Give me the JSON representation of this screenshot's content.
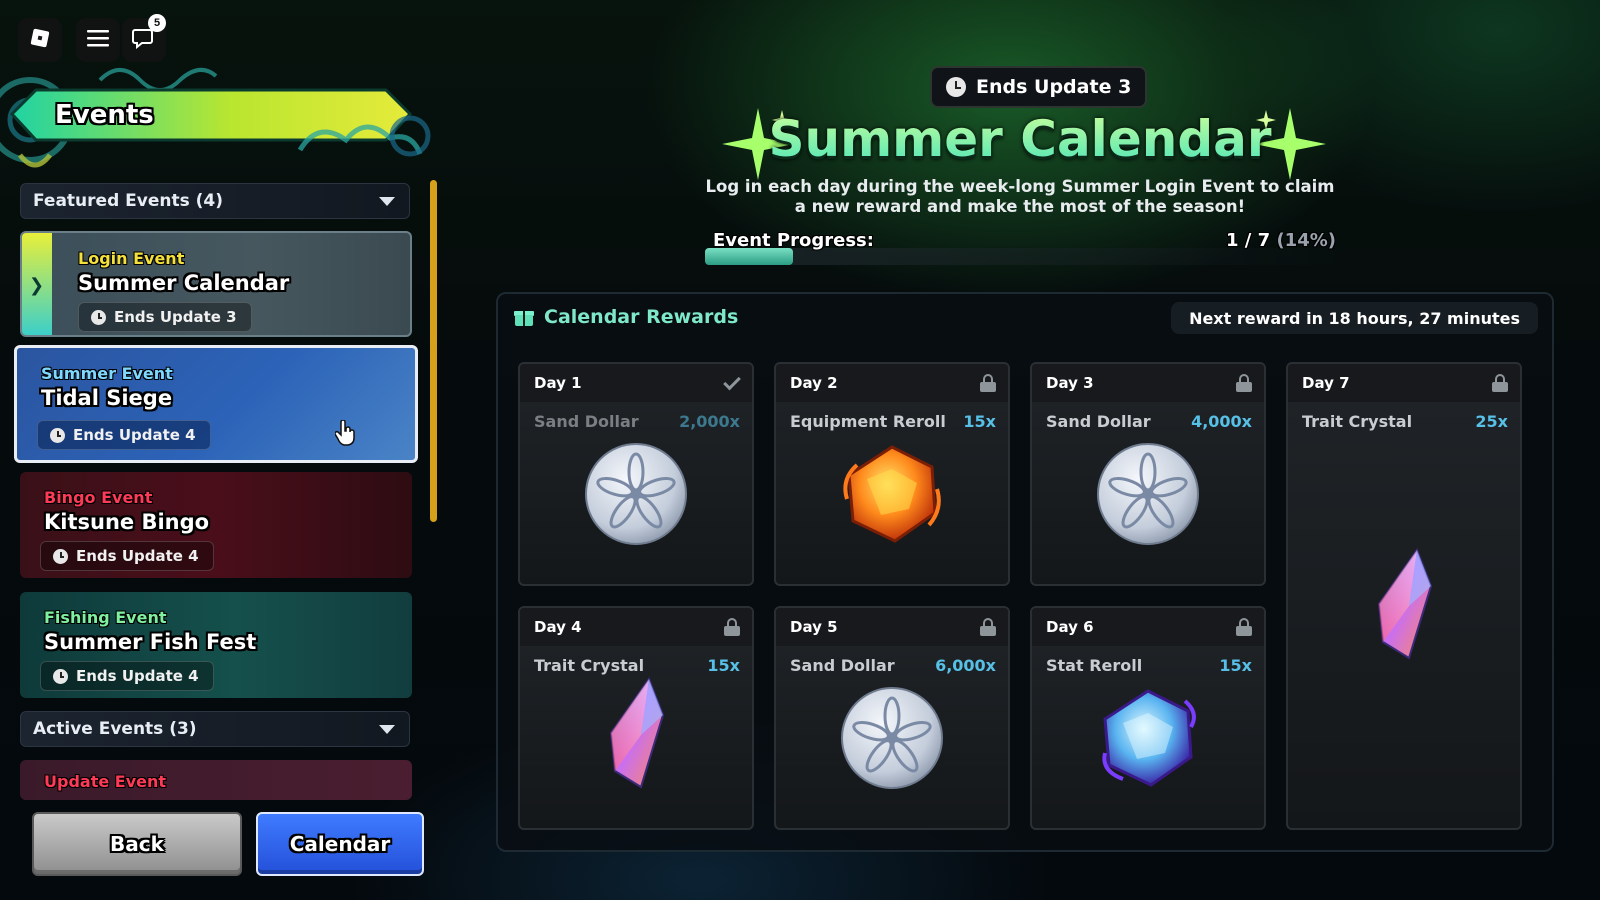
{
  "topbar": {
    "roblox_icon": "roblox-logo-icon",
    "menu_icon": "hamburger-menu-icon",
    "chat_icon": "chat-icon",
    "chat_badge": "5"
  },
  "sidebar": {
    "title": "Events",
    "featured_header": "Featured Events (4)",
    "active_header": "Active Events (3)",
    "events": [
      {
        "category": "Login Event",
        "name": "Summer Calendar",
        "ends": "Ends Update 3",
        "category_color": "#f5e13b"
      },
      {
        "category": "Summer Event",
        "name": "Tidal Siege",
        "ends": "Ends Update 4",
        "category_color": "#7fd8ff"
      },
      {
        "category": "Bingo Event",
        "name": "Kitsune Bingo",
        "ends": "Ends Update 4",
        "category_color": "#ff3a57"
      },
      {
        "category": "Fishing Event",
        "name": "Summer Fish Fest",
        "ends": "Ends Update 4",
        "category_color": "#7ff0a0"
      }
    ],
    "active_events": [
      {
        "category": "Update Event",
        "category_color": "#ff3a57"
      }
    ],
    "back_label": "Back",
    "calendar_label": "Calendar"
  },
  "header": {
    "ends": "Ends Update 3",
    "title": "Summer Calendar",
    "subtitle": "Log in each day during the week-long Summer Login Event to claim a new reward and make the most of the season!",
    "progress_label": "Event Progress:",
    "progress_value": "1 / 7",
    "progress_pct": "(14%)",
    "progress_fraction": 0.14
  },
  "rewards": {
    "title": "Calendar Rewards",
    "next_reward": "Next reward in 18 hours, 27 minutes",
    "days": [
      {
        "day": "Day 1",
        "item": "Sand Dollar",
        "qty": "2,000x",
        "status": "claimed",
        "icon": "sand-dollar"
      },
      {
        "day": "Day 2",
        "item": "Equipment Reroll",
        "qty": "15x",
        "status": "locked",
        "icon": "equipment-reroll"
      },
      {
        "day": "Day 3",
        "item": "Sand Dollar",
        "qty": "4,000x",
        "status": "locked",
        "icon": "sand-dollar"
      },
      {
        "day": "Day 7",
        "item": "Trait Crystal",
        "qty": "25x",
        "status": "locked",
        "icon": "trait-crystal"
      },
      {
        "day": "Day 4",
        "item": "Trait Crystal",
        "qty": "15x",
        "status": "locked",
        "icon": "trait-crystal"
      },
      {
        "day": "Day 5",
        "item": "Sand Dollar",
        "qty": "6,000x",
        "status": "locked",
        "icon": "sand-dollar"
      },
      {
        "day": "Day 6",
        "item": "Stat Reroll",
        "qty": "15x",
        "status": "locked",
        "icon": "stat-reroll"
      }
    ]
  },
  "colors": {
    "accent_green": "#7ee8c8",
    "qty_blue": "#57c0e6",
    "calendar_button": "#2a5fe0"
  }
}
